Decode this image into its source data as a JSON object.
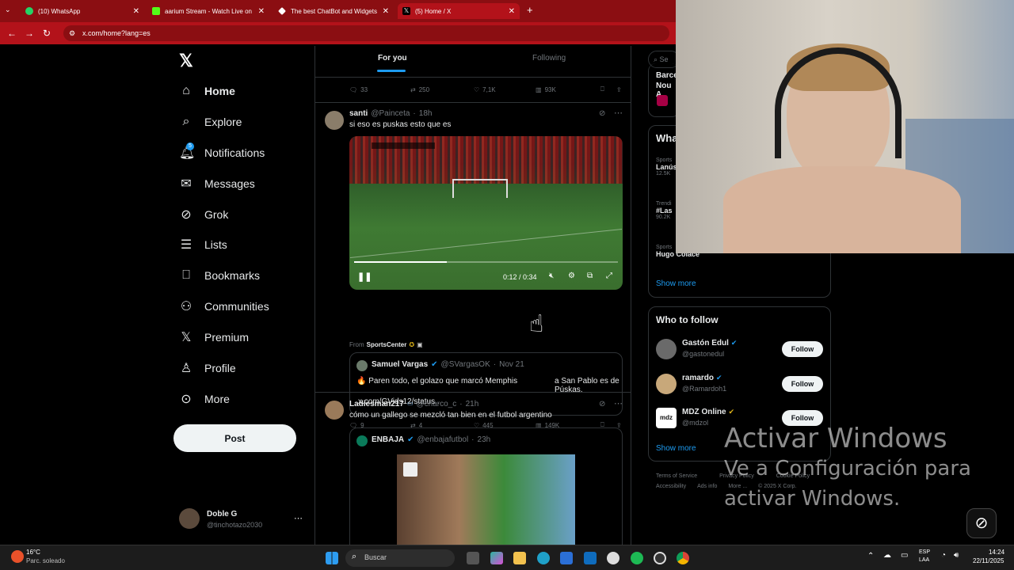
{
  "browser": {
    "tabs": [
      {
        "label": "(10) WhatsApp",
        "color": "#25d366"
      },
      {
        "label": "aarium Stream - Watch Live on",
        "color": "#53fc18"
      },
      {
        "label": "The best ChatBot and Widgets",
        "color": "#ffffff"
      },
      {
        "label": "(5) Home / X",
        "color": "#000000"
      }
    ],
    "url": "x.com/home?lang=es"
  },
  "nav": {
    "items": [
      {
        "label": "Home",
        "icon": "home-icon"
      },
      {
        "label": "Explore",
        "icon": "search-icon"
      },
      {
        "label": "Notifications",
        "icon": "bell-icon",
        "badge": "5"
      },
      {
        "label": "Messages",
        "icon": "envelope-icon"
      },
      {
        "label": "Grok",
        "icon": "grok-icon"
      },
      {
        "label": "Lists",
        "icon": "list-icon"
      },
      {
        "label": "Bookmarks",
        "icon": "bookmark-icon"
      },
      {
        "label": "Communities",
        "icon": "communities-icon"
      },
      {
        "label": "Premium",
        "icon": "x-logo-icon"
      },
      {
        "label": "Profile",
        "icon": "person-icon"
      },
      {
        "label": "More",
        "icon": "more-circle-icon"
      }
    ],
    "post_label": "Post",
    "profile": {
      "name": "Doble G",
      "handle": "@tinchotazo2030"
    }
  },
  "timeline": {
    "tabs": {
      "foryou": "For you",
      "following": "Following"
    },
    "top_actions": {
      "replies": "33",
      "reposts": "250",
      "likes": "7,1K",
      "views": "93K"
    },
    "post1": {
      "name": "santi",
      "handle": "@Painceta",
      "time": "18h",
      "text": "si eso es puskas esto que es",
      "video_time": "0:12 / 0:34",
      "from_label": "From",
      "from_source": "SportsCenter",
      "quote": {
        "name": "Samuel Vargas",
        "handle": "@SVargasOK",
        "time": "Nov 21",
        "text1": "🔥 Paren todo, el golazo que marcó Memphis",
        "text2": "a San Pablo es de Púskas.",
        "link": "x.com/GVids12/status..."
      },
      "actions": {
        "replies": "9",
        "reposts": "4",
        "likes": "445",
        "views": "149K"
      }
    },
    "post2": {
      "name": "Ladiesman217",
      "handle": "@charco_c",
      "time": "21h",
      "text": "cómo un gallego se mezcló tan bien en el futbol argentino",
      "quote": {
        "name": "ENBAJA",
        "handle": "@enbajafutbol",
        "time": "23h"
      }
    }
  },
  "right": {
    "search_placeholder": "Se",
    "event": {
      "line1": "Barce",
      "line2": "Nou A"
    },
    "whats_title": "Wha",
    "trends": [
      {
        "category": "Sports",
        "title": "Lanús",
        "count": "12.5K"
      },
      {
        "category": "Trendi",
        "title": "#Las",
        "count": "90.2K"
      },
      {
        "category": "Sports",
        "title": "Hugo Colace",
        "count": ""
      }
    ],
    "show_more": "Show more",
    "who_title": "Who to follow",
    "who": [
      {
        "name": "Gastón Edul",
        "handle": "@gastonedul",
        "badge_color": "#1d9bf0"
      },
      {
        "name": "ramardo",
        "handle": "@Ramardoh1",
        "badge_color": "#1d9bf0"
      },
      {
        "name": "MDZ Online",
        "handle": "@mdzol",
        "badge_color": "#e2b719"
      }
    ],
    "follow_label": "Follow",
    "footer": {
      "row1": [
        "Terms of Service",
        "Privacy Policy",
        "Cookie Policy"
      ],
      "row2": [
        "Accessibility",
        "Ads info",
        "More ...",
        "© 2025 X Corp."
      ]
    }
  },
  "overlay": {
    "activate_title": "Activar Windows",
    "activate_sub1": "Ve a Configuración para",
    "activate_sub2": "activar Windows."
  },
  "taskbar": {
    "weather_temp": "16°C",
    "weather_desc": "Parc. soleado",
    "search_placeholder": "Buscar",
    "lang1": "ESP",
    "lang2": "LAA",
    "time": "14:24",
    "date": "22/11/2025"
  }
}
